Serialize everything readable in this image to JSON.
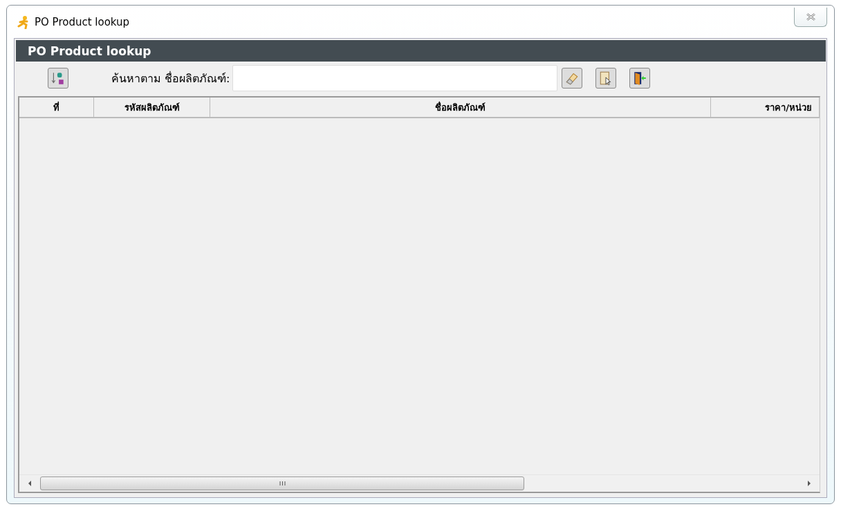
{
  "window": {
    "title": "PO Product lookup"
  },
  "panel": {
    "title": "PO Product lookup"
  },
  "search": {
    "label": "ค้นหาตาม ชื่อผลิตภัณฑ์:"
  },
  "table": {
    "columns": [
      {
        "label": "ที่"
      },
      {
        "label": "รหัสผลิตภัณฑ์"
      },
      {
        "label": "ชื่อผลิตภัณฑ์"
      },
      {
        "label": "ราคา/หน่วย"
      }
    ]
  }
}
